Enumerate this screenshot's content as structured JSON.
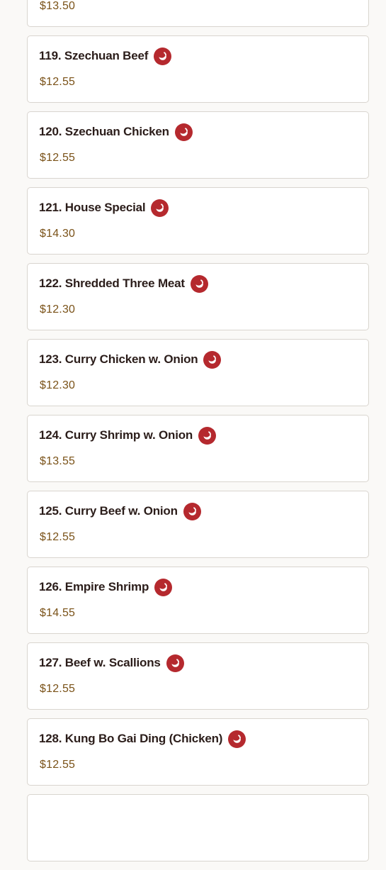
{
  "menu": {
    "accent_color": "#b5292e",
    "price_color": "#7a5218",
    "icon": "chili-pepper-icon",
    "items": [
      {
        "name": "",
        "price": "$13.50",
        "spicy": false
      },
      {
        "name": "119. Szechuan Beef",
        "price": "$12.55",
        "spicy": true
      },
      {
        "name": "120. Szechuan Chicken",
        "price": "$12.55",
        "spicy": true
      },
      {
        "name": "121. House Special",
        "price": "$14.30",
        "spicy": true
      },
      {
        "name": "122. Shredded Three Meat",
        "price": "$12.30",
        "spicy": true
      },
      {
        "name": "123. Curry Chicken w. Onion",
        "price": "$12.30",
        "spicy": true
      },
      {
        "name": "124. Curry Shrimp w. Onion",
        "price": "$13.55",
        "spicy": true
      },
      {
        "name": "125. Curry Beef w. Onion",
        "price": "$12.55",
        "spicy": true
      },
      {
        "name": "126. Empire Shrimp",
        "price": "$14.55",
        "spicy": true
      },
      {
        "name": "127. Beef w. Scallions",
        "price": "$12.55",
        "spicy": true
      },
      {
        "name": "128. Kung Bo Gai Ding (Chicken)",
        "price": "$12.55",
        "spicy": true
      },
      {
        "name": "",
        "price": "",
        "spicy": false
      }
    ]
  }
}
